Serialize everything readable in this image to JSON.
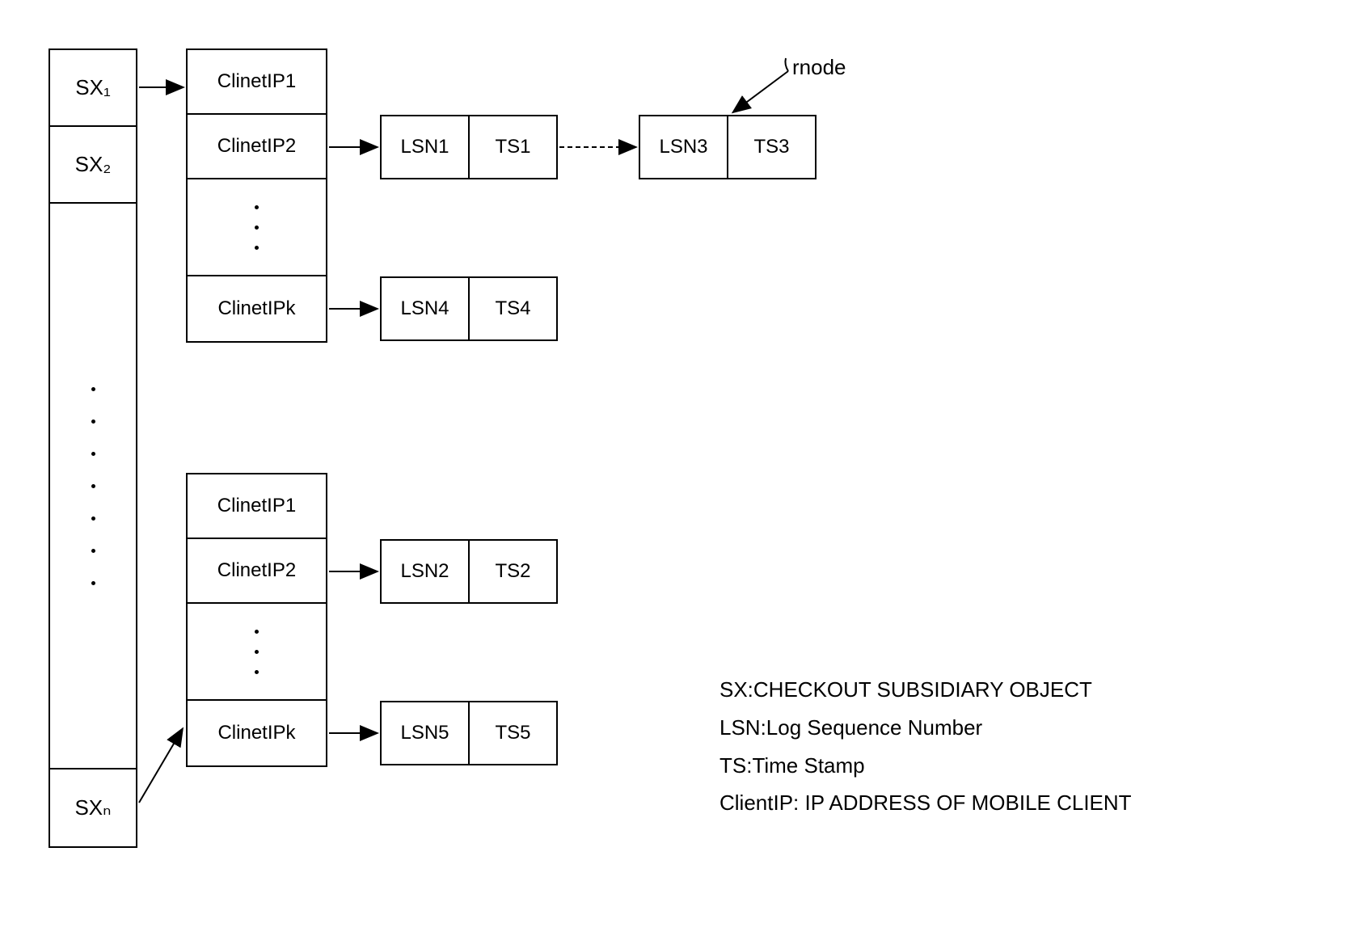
{
  "sx_column": {
    "sx1": "SX₁",
    "sx2": "SX₂",
    "sxn": "SXₙ"
  },
  "client_column_1": {
    "ip1": "ClinetIP1",
    "ip2": "ClinetIP2",
    "ipk": "ClinetIPk"
  },
  "client_column_2": {
    "ip1": "ClinetIP1",
    "ip2": "ClinetIP2",
    "ipk": "ClinetIPk"
  },
  "rnode1": {
    "lsn": "LSN1",
    "ts": "TS1"
  },
  "rnode2": {
    "lsn": "LSN3",
    "ts": "TS3"
  },
  "rnode3": {
    "lsn": "LSN4",
    "ts": "TS4"
  },
  "rnode4": {
    "lsn": "LSN2",
    "ts": "TS2"
  },
  "rnode5": {
    "lsn": "LSN5",
    "ts": "TS5"
  },
  "rnode_label": "rnode",
  "legend": {
    "sx": "SX:CHECKOUT SUBSIDIARY OBJECT",
    "lsn": "LSN:Log Sequence Number",
    "ts": "TS:Time Stamp",
    "clientip": "ClientIP: IP ADDRESS OF MOBILE CLIENT"
  }
}
